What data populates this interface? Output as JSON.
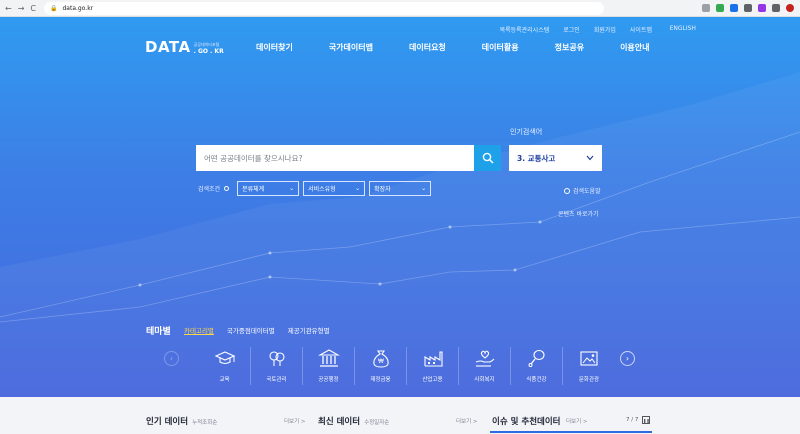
{
  "browser": {
    "url": "data.go.kr",
    "back": "←",
    "forward": "→",
    "reload": "C"
  },
  "toplinks": [
    "목록등록관리시스템",
    "로그인",
    "회원가입",
    "사이트맵",
    "ENGLISH"
  ],
  "logo": {
    "main": "DATA",
    "sub1": "공공데이터포털",
    "sub2": ". GO . KR"
  },
  "gnb": [
    "데이터찾기",
    "국가데이터맵",
    "데이터요청",
    "데이터활용",
    "정보공유",
    "이용안내"
  ],
  "search": {
    "placeholder": "어떤 공공데이터를 찾으시나요?",
    "popular_label": "인기검색어",
    "popular_value": "3. 교통사고"
  },
  "filters": {
    "cond_label": "검색조건",
    "selects": [
      "분류체계",
      "서비스유형",
      "확장자"
    ],
    "help": "검색도움말",
    "contents": "콘텐츠 바로가기"
  },
  "theme": {
    "title": "테마별",
    "tabs": [
      "카테고리별",
      "국가중점데이터별",
      "제공기관유형별"
    ],
    "categories": [
      "교육",
      "국토관리",
      "공공행정",
      "재정금융",
      "산업고용",
      "사회복지",
      "식품건강",
      "문화관광"
    ]
  },
  "bottom": {
    "popular": {
      "title": "인기 데이터",
      "sub": "누적조회순",
      "more": "더보기 >"
    },
    "latest": {
      "title": "최신 데이터",
      "sub": "수정일자순",
      "more": "더보기 >"
    },
    "issue": {
      "title": "이슈 및 추천데이터",
      "more": "더보기 >"
    },
    "pager": "7 / 7"
  },
  "colors": {
    "hero_top": "#2f9bf0",
    "hero_bottom": "#4565dc",
    "search_btn": "#1ea1e9",
    "active_tab": "#ffd84a"
  }
}
